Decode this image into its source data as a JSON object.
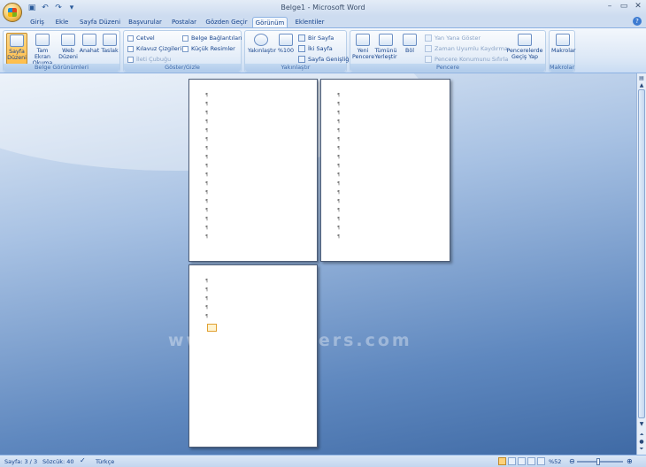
{
  "app": {
    "title": "Belge1 - Microsoft Word",
    "qat_icons": [
      "save-icon",
      "undo-icon",
      "redo-icon",
      "customize-icon"
    ],
    "win_controls": [
      "–",
      "▭",
      "✕"
    ]
  },
  "tabs": [
    {
      "label": "Giriş",
      "active": false
    },
    {
      "label": "Ekle",
      "active": false
    },
    {
      "label": "Sayfa Düzeni",
      "active": false
    },
    {
      "label": "Başvurular",
      "active": false
    },
    {
      "label": "Postalar",
      "active": false
    },
    {
      "label": "Gözden Geçir",
      "active": false
    },
    {
      "label": "Görünüm",
      "active": true
    },
    {
      "label": "Eklentiler",
      "active": false
    }
  ],
  "ribbon": {
    "views": {
      "label": "Belge Görünümleri",
      "buttons": [
        {
          "label": "Sayfa Düzeni",
          "selected": true
        },
        {
          "label": "Tam Ekran Okuma",
          "selected": false
        },
        {
          "label": "Web Düzeni",
          "selected": false
        },
        {
          "label": "Anahat",
          "selected": false
        },
        {
          "label": "Taslak",
          "selected": false
        }
      ]
    },
    "showhide": {
      "label": "Göster/Gizle",
      "items": [
        {
          "label": "Cetvel",
          "checked": false,
          "disabled": false
        },
        {
          "label": "Kılavuz Çizgileri",
          "checked": false,
          "disabled": false
        },
        {
          "label": "İleti Çubuğu",
          "checked": false,
          "disabled": true
        },
        {
          "label": "Belge Bağlantıları",
          "checked": false,
          "disabled": false
        },
        {
          "label": "Küçük Resimler",
          "checked": false,
          "disabled": false
        }
      ]
    },
    "zoom": {
      "label": "Yakınlaştır",
      "zoom_btn": "Yakınlaştır",
      "hundred_btn": "%100",
      "one_page": "Bir Sayfa",
      "two_pages": "İki Sayfa",
      "page_width": "Sayfa Genişliği"
    },
    "window": {
      "label": "Pencere",
      "new_window": "Yeni Pencere",
      "arrange_all": "Tümünü Yerleştir",
      "split": "Böl",
      "side_by_side": "Yan Yana Göster",
      "sync_scroll": "Zaman Uyumlu Kaydırma",
      "reset_pos": "Pencere Konumunu Sıfırla",
      "switch_windows": "Pencerelerde Geçiş Yap"
    },
    "macros": {
      "label": "Makrolar",
      "btn": "Makrolar"
    }
  },
  "document": {
    "para_mark": "¶",
    "watermark": "www.dijitalders.com"
  },
  "status": {
    "page": "Sayfa: 3 / 3",
    "words": "Sözcük: 40",
    "language": "Türkçe",
    "zoom": "%52"
  }
}
